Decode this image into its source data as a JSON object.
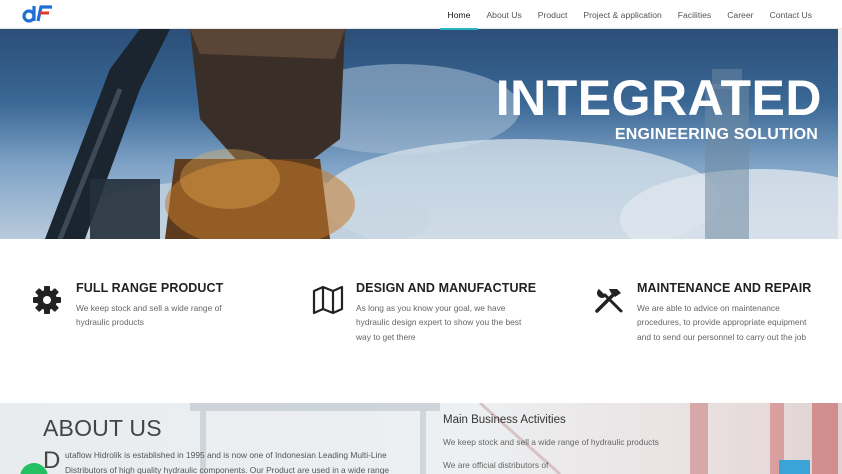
{
  "brand": {
    "logo_text": "dF",
    "colors": {
      "logo_blue": "#1f6fd6",
      "logo_red": "#e03a2b",
      "accent": "#2bb3c4"
    }
  },
  "nav": {
    "items": [
      {
        "label": "Home",
        "active": true
      },
      {
        "label": "About Us"
      },
      {
        "label": "Product"
      },
      {
        "label": "Project & application"
      },
      {
        "label": "Facilities"
      },
      {
        "label": "Career"
      },
      {
        "label": "Contact Us"
      }
    ]
  },
  "hero": {
    "title": "INTEGRATED",
    "subtitle": "ENGINEERING SOLUTION"
  },
  "features": [
    {
      "icon": "gear-icon",
      "title": "FULL RANGE PRODUCT",
      "text": "We keep stock and sell a wide range of hydraulic products"
    },
    {
      "icon": "map-icon",
      "title": "DESIGN AND MANUFACTURE",
      "text": "As long as you know your goal, we have hydraulic design expert to show you the best way to get there"
    },
    {
      "icon": "tools-icon",
      "title": "MAINTENANCE AND REPAIR",
      "text": "We are able to advice on maintenance procedures, to provide appropriate equipment and to send our personnel to carry out the job"
    }
  ],
  "about": {
    "title": "ABOUT US",
    "dropcap": "D",
    "text": "utaflow Hidrolik is established in 1995 and is now one of Indonesian Leading Multi-Line Distributors of high quality hydraulic components. Our Product are used in a wide range"
  },
  "business": {
    "title": "Main Business Activities",
    "items": [
      "We keep stock and sell a wide range of hydraulic products",
      "We are official distributors of"
    ]
  },
  "widgets": {
    "chat_color": "#25c061",
    "back_to_top_color": "#3aa3d8"
  }
}
